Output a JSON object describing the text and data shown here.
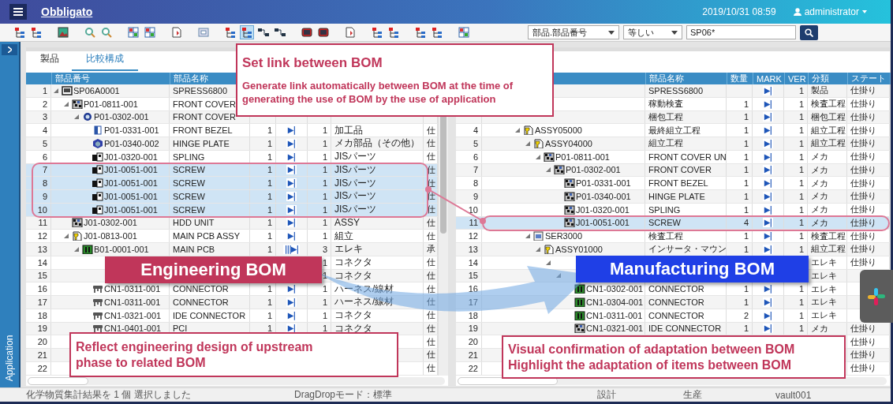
{
  "header": {
    "title": "Obbligato",
    "datetime": "2019/10/31 08:59",
    "user": "administrator"
  },
  "toolbar": {
    "groups": [
      [
        {
          "kind": "hierarchy",
          "selected": false
        },
        {
          "kind": "hierarchy",
          "selected": false
        }
      ],
      [
        {
          "kind": "picture",
          "selected": false
        }
      ],
      [
        {
          "kind": "magnifier",
          "selected": false
        },
        {
          "kind": "magnifier",
          "selected": false
        }
      ],
      [
        {
          "kind": "grid",
          "selected": false
        },
        {
          "kind": "grid",
          "selected": false
        }
      ],
      [
        {
          "kind": "page",
          "selected": false
        }
      ],
      [
        {
          "kind": "frame",
          "selected": false
        }
      ],
      [
        {
          "kind": "hierarchy",
          "selected": false
        },
        {
          "kind": "hierarchy",
          "selected": true
        },
        {
          "kind": "network",
          "selected": false
        },
        {
          "kind": "network",
          "selected": false
        }
      ],
      [
        {
          "kind": "monitor",
          "selected": false
        },
        {
          "kind": "monitor",
          "selected": false
        }
      ],
      [
        {
          "kind": "page",
          "selected": false
        }
      ],
      [
        {
          "kind": "hierarchy",
          "selected": false
        },
        {
          "kind": "hierarchy",
          "selected": false
        }
      ],
      [
        {
          "kind": "hierarchy",
          "selected": false
        },
        {
          "kind": "hierarchy",
          "selected": false
        }
      ],
      [
        {
          "kind": "grid",
          "selected": false
        }
      ]
    ],
    "search": {
      "field": "部品.部品番号",
      "operator": "等しい",
      "value": "SP06*"
    }
  },
  "sidebar": {
    "label": "Application"
  },
  "panels": [
    {
      "tabs": [
        {
          "label": "製品",
          "selected": false
        },
        {
          "label": "比較構成",
          "selected": true
        }
      ],
      "columns": {
        "part": "部品番号",
        "name": "部品名称"
      },
      "rows": [
        {
          "no": "1",
          "part": "SP06A0001",
          "name": "SPRESS6800",
          "kind": "product",
          "selected": false,
          "expanded": true,
          "children": [
            {
              "no": "2",
              "part": "P01-0811-001",
              "name": "FRONT COVER",
              "kind": "unit",
              "selected": false,
              "expanded": true,
              "children": [
                {
                  "no": "3",
                  "part": "P01-0302-001",
                  "name": "FRONT COVER",
                  "kind": "round",
                  "selected": false,
                  "expanded": true,
                  "children": [
                    {
                      "no": "4",
                      "part": "P01-0331-001",
                      "name": "FRONT BEZEL",
                      "qty": "1",
                      "mark": "▶|",
                      "ver": "1",
                      "category": "加工品",
                      "status": "仕",
                      "kind": "half",
                      "selected": false
                    },
                    {
                      "no": "5",
                      "part": "P01-0340-002",
                      "name": "HINGE PLATE",
                      "qty": "1",
                      "mark": "▶|",
                      "ver": "1",
                      "category": "メカ部品（その他）",
                      "status": "仕",
                      "kind": "module",
                      "selected": false
                    },
                    {
                      "no": "6",
                      "part": "J01-0320-001",
                      "name": "SPLING",
                      "qty": "1",
                      "mark": "▶|",
                      "ver": "1",
                      "category": "JISパーツ",
                      "status": "仕",
                      "kind": "screw",
                      "selected": false
                    },
                    {
                      "no": "7",
                      "part": "J01-0051-001",
                      "name": "SCREW",
                      "qty": "1",
                      "mark": "▶|",
                      "ver": "1",
                      "category": "JISパーツ",
                      "status": "仕",
                      "kind": "screw",
                      "selected": true
                    },
                    {
                      "no": "8",
                      "part": "J01-0051-001",
                      "name": "SCREW",
                      "qty": "1",
                      "mark": "▶|",
                      "ver": "1",
                      "category": "JISパーツ",
                      "status": "仕",
                      "kind": "screw",
                      "selected": true
                    },
                    {
                      "no": "9",
                      "part": "J01-0051-001",
                      "name": "SCREW",
                      "qty": "1",
                      "mark": "▶|",
                      "ver": "1",
                      "category": "JISパーツ",
                      "status": "仕",
                      "kind": "screw",
                      "selected": true
                    },
                    {
                      "no": "10",
                      "part": "J01-0051-001",
                      "name": "SCREW",
                      "qty": "1",
                      "mark": "▶|",
                      "ver": "1",
                      "category": "JISパーツ",
                      "status": "仕",
                      "kind": "screw",
                      "selected": true
                    }
                  ]
                }
              ]
            },
            {
              "no": "11",
              "part": "J01-0302-001",
              "name": "HDD UNIT",
              "qty": "1",
              "mark": "▶|",
              "ver": "1",
              "category": "ASSY",
              "status": "仕",
              "kind": "unit",
              "selected": false
            },
            {
              "no": "12",
              "part": "J01-0813-001",
              "name": "MAIN PCB ASSY",
              "qty": "1",
              "mark": "▶|",
              "ver": "1",
              "category": "組立",
              "status": "仕",
              "kind": "process",
              "selected": false,
              "expanded": true,
              "children": [
                {
                  "no": "13",
                  "part": "B01-0001-001",
                  "name": "MAIN PCB",
                  "qty": "1",
                  "mark": "|||▶|",
                  "ver": "3",
                  "category": "エレキ",
                  "status": "承",
                  "kind": "board",
                  "selected": false,
                  "expanded": true,
                  "children": [
                    {
                      "no": "14",
                      "ver": "1",
                      "category": "コネクタ",
                      "status": "仕",
                      "selected": false
                    },
                    {
                      "no": "15",
                      "ver": "1",
                      "category": "コネクタ",
                      "status": "仕",
                      "selected": false
                    },
                    {
                      "no": "16",
                      "part": "CN1-0311-001",
                      "name": "CONNECTOR",
                      "qty": "1",
                      "mark": "▶|",
                      "ver": "1",
                      "category": "ハーネス/線材",
                      "status": "仕",
                      "kind": "connector",
                      "selected": false
                    },
                    {
                      "no": "17",
                      "part": "CN1-0311-001",
                      "name": "CONNECTOR",
                      "qty": "1",
                      "mark": "▶|",
                      "ver": "1",
                      "category": "ハーネス/線材",
                      "status": "仕",
                      "kind": "connector",
                      "selected": false
                    },
                    {
                      "no": "18",
                      "part": "CN1-0321-001",
                      "name": "IDE CONNECTOR",
                      "qty": "1",
                      "mark": "▶|",
                      "ver": "1",
                      "category": "コネクタ",
                      "status": "仕",
                      "kind": "connector",
                      "selected": false
                    },
                    {
                      "no": "19",
                      "part": "CN1-0401-001",
                      "name": "PCI",
                      "qty": "1",
                      "mark": "▶|",
                      "ver": "1",
                      "category": "コネクタ",
                      "status": "仕",
                      "kind": "connector",
                      "selected": false
                    },
                    {
                      "no": "20",
                      "status": "仕",
                      "selected": false
                    },
                    {
                      "no": "21",
                      "status": "仕",
                      "selected": false
                    },
                    {
                      "no": "22",
                      "status": "仕",
                      "selected": false
                    }
                  ]
                }
              ]
            }
          ]
        }
      ]
    },
    {
      "columns": {
        "name": "部品名称",
        "qty": "数量",
        "mark": "MARK",
        "ver": "VER",
        "category": "分類",
        "status": "ステート"
      },
      "rows": [
        {
          "name": "SPRESS6800",
          "mark": "▶|",
          "ver": "1",
          "category": "製品",
          "status": "仕掛り",
          "selected": false,
          "children": [
            {
              "name": "稼動検査",
              "qty": "1",
              "mark": "▶|",
              "ver": "1",
              "category": "検査工程",
              "status": "仕掛り",
              "selected": false,
              "children": [
                {
                  "name": "梱包工程",
                  "qty": "1",
                  "mark": "▶|",
                  "ver": "1",
                  "category": "梱包工程",
                  "status": "仕掛り",
                  "selected": false,
                  "children": [
                    {
                      "no": "4",
                      "part": "ASSY05000",
                      "name": "最終組立工程",
                      "qty": "1",
                      "mark": "▶|",
                      "ver": "1",
                      "category": "組立工程",
                      "status": "仕掛り",
                      "kind": "process",
                      "selected": false,
                      "expanded": true,
                      "children": [
                        {
                          "no": "5",
                          "part": "ASSY04000",
                          "name": "組立工程",
                          "qty": "1",
                          "mark": "▶|",
                          "ver": "1",
                          "category": "組立工程",
                          "status": "仕掛り",
                          "kind": "process",
                          "selected": false,
                          "expanded": true,
                          "children": [
                            {
                              "no": "6",
                              "part": "P01-0811-001",
                              "name": "FRONT COVER UN",
                              "qty": "1",
                              "mark": "▶|",
                              "ver": "1",
                              "category": "メカ",
                              "status": "仕掛り",
                              "kind": "unit",
                              "selected": false,
                              "expanded": true,
                              "children": [
                                {
                                  "no": "7",
                                  "part": "P01-0302-001",
                                  "name": "FRONT COVER",
                                  "qty": "1",
                                  "mark": "▶|",
                                  "ver": "1",
                                  "category": "メカ",
                                  "status": "仕掛り",
                                  "kind": "unit",
                                  "selected": false,
                                  "expanded": true,
                                  "children": [
                                    {
                                      "no": "8",
                                      "part": "P01-0331-001",
                                      "name": "FRONT BEZEL",
                                      "qty": "1",
                                      "mark": "▶|",
                                      "ver": "1",
                                      "category": "メカ",
                                      "status": "仕掛り",
                                      "kind": "unit",
                                      "selected": false
                                    },
                                    {
                                      "no": "9",
                                      "part": "P01-0340-001",
                                      "name": "HINGE PLATE",
                                      "qty": "1",
                                      "mark": "▶|",
                                      "ver": "1",
                                      "category": "メカ",
                                      "status": "仕掛り",
                                      "kind": "unit",
                                      "selected": false
                                    },
                                    {
                                      "no": "10",
                                      "part": "J01-0320-001",
                                      "name": "SPLING",
                                      "qty": "1",
                                      "mark": "▶|",
                                      "ver": "1",
                                      "category": "メカ",
                                      "status": "仕掛り",
                                      "kind": "unit",
                                      "selected": false
                                    },
                                    {
                                      "no": "11",
                                      "part": "J01-0051-001",
                                      "name": "SCREW",
                                      "qty": "4",
                                      "mark": "▶|",
                                      "ver": "1",
                                      "category": "メカ",
                                      "status": "仕掛り",
                                      "kind": "unit",
                                      "selected": true
                                    }
                                  ]
                                }
                              ]
                            }
                          ]
                        },
                        {
                          "no": "12",
                          "part": "SER3000",
                          "name": "検査工程",
                          "qty": "1",
                          "mark": "▶|",
                          "ver": "1",
                          "category": "検査工程",
                          "status": "仕掛り",
                          "kind": "inspect",
                          "selected": false,
                          "expanded": true,
                          "children": [
                            {
                              "no": "13",
                              "part": "ASSY01000",
                              "name": "インサータ・マウン",
                              "qty": "1",
                              "mark": "▶|",
                              "ver": "1",
                              "category": "組立工程",
                              "status": "仕掛り",
                              "kind": "process",
                              "selected": false,
                              "expanded": true,
                              "children": [
                                {
                                  "no": "14",
                                  "category": "エレキ",
                                  "status": "仕掛り",
                                  "selected": false,
                                  "expanded": true,
                                  "children": [
                                    {
                                      "no": "15",
                                      "category": "エレキ",
                                      "selected": false,
                                      "expanded": true,
                                      "children": [
                                        {
                                          "no": "16",
                                          "part": "CN1-0302-001",
                                          "name": "CONNECTOR",
                                          "qty": "1",
                                          "mark": "▶|",
                                          "ver": "1",
                                          "category": "エレキ",
                                          "kind": "board",
                                          "selected": false
                                        },
                                        {
                                          "no": "17",
                                          "part": "CN1-0304-001",
                                          "name": "CONNECTOR",
                                          "qty": "1",
                                          "mark": "▶|",
                                          "ver": "1",
                                          "category": "エレキ",
                                          "kind": "board",
                                          "selected": false
                                        },
                                        {
                                          "no": "18",
                                          "part": "CN1-0311-001",
                                          "name": "CONNECTOR",
                                          "qty": "2",
                                          "mark": "▶|",
                                          "ver": "1",
                                          "category": "エレキ",
                                          "kind": "board",
                                          "selected": false
                                        },
                                        {
                                          "no": "19",
                                          "part": "CN1-0321-001",
                                          "name": "IDE CONNECTOR",
                                          "qty": "1",
                                          "mark": "▶|",
                                          "ver": "1",
                                          "category": "メカ",
                                          "status": "仕掛り",
                                          "kind": "unit",
                                          "selected": false
                                        },
                                        {
                                          "no": "20",
                                          "status": "仕掛り",
                                          "selected": false
                                        },
                                        {
                                          "no": "21",
                                          "status": "仕掛り",
                                          "selected": false
                                        },
                                        {
                                          "no": "22",
                                          "status": "仕掛り",
                                          "selected": false
                                        }
                                      ]
                                    }
                                  ]
                                }
                              ]
                            }
                          ]
                        }
                      ]
                    }
                  ]
                }
              ]
            }
          ]
        }
      ]
    }
  ],
  "callouts": [
    {
      "kind": "note",
      "title": "Set link between BOM",
      "lines": [
        "Generate link automatically between BOM at the time of",
        "generating the use of BOM by the use of application"
      ]
    },
    {
      "kind": "banner",
      "text": "Engineering BOM",
      "color": "#c0365a"
    },
    {
      "kind": "banner",
      "text": "Manufacturing BOM",
      "color": "#1f3fe6"
    },
    {
      "kind": "note",
      "lines": [
        "Reflect engineering design of upstream",
        "phase to related BOM"
      ]
    },
    {
      "kind": "note",
      "lines": [
        "Visual confirmation of adaptation between BOM",
        "Highlight the adaptation of items between BOM"
      ]
    }
  ],
  "status_bar": [
    "化学物質集計結果を 1 個 選択しました",
    "DragDropモード：標準",
    "設計",
    "生産",
    "vault001"
  ]
}
